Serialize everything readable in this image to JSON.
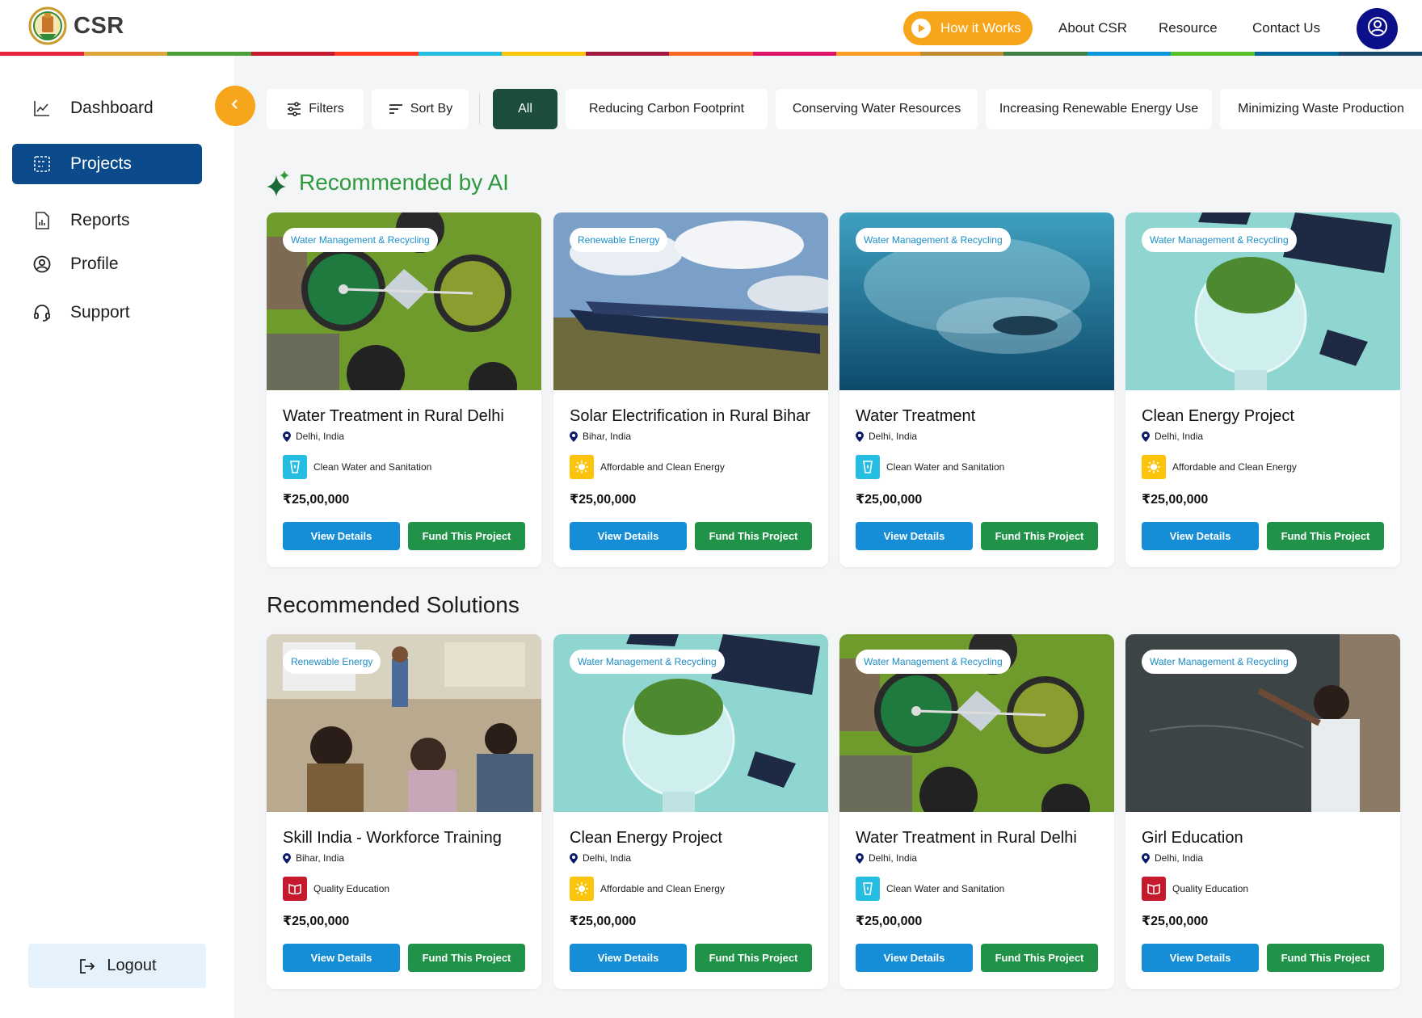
{
  "header": {
    "brand": "CSR",
    "nav": {
      "how_it_works": "How it Works",
      "about": "About CSR",
      "resource": "Resource",
      "contact": "Contact Us"
    },
    "icons": {
      "logo": "state-emblem-logo",
      "play": "play-icon",
      "user": "user-circle-icon"
    },
    "stripe_colors": [
      "#e5243b",
      "#dda63a",
      "#4c9f38",
      "#c5192d",
      "#ff3a21",
      "#26bde2",
      "#fcc30b",
      "#a21942",
      "#fd6925",
      "#dd1367",
      "#fd9d24",
      "#bf8b2e",
      "#3f7e44",
      "#0a97d9",
      "#56c02b",
      "#00689d",
      "#19486a"
    ]
  },
  "sidebar": {
    "items": [
      {
        "label": "Dashboard",
        "icon": "chart-line-icon"
      },
      {
        "label": "Projects",
        "icon": "projects-icon"
      },
      {
        "label": "Reports",
        "icon": "report-icon"
      },
      {
        "label": "Profile",
        "icon": "profile-icon"
      },
      {
        "label": "Support",
        "icon": "headset-icon"
      }
    ],
    "logout": "Logout"
  },
  "filters": {
    "filters_label": "Filters",
    "sort_label": "Sort By",
    "chips": [
      "All",
      "Reducing Carbon Footprint",
      "Conserving Water Resources",
      "Increasing Renewable Energy Use",
      "Minimizing Waste Production"
    ],
    "active_chip": "All"
  },
  "sections": {
    "ai": "Recommended by AI",
    "solutions": "Recommended Solutions"
  },
  "cards_ai": [
    {
      "tag": "Water Management & Recycling",
      "title": "Water Treatment in Rural Delhi",
      "location": "Delhi, India",
      "sdg": "Clean Water and Sanitation",
      "sdg_color": "#26bde2",
      "price": "₹25,00,000",
      "view": "View Details",
      "fund": "Fund This Project",
      "image": "water-treatment-aerial"
    },
    {
      "tag": "Renewable Energy",
      "title": "Solar Electrification in Rural Bihar",
      "location": "Bihar, India",
      "sdg": "Affordable and Clean Energy",
      "sdg_color": "#fcc30b",
      "price": "₹25,00,000",
      "view": "View Details",
      "fund": "Fund This Project",
      "image": "solar-farm"
    },
    {
      "tag": "Water Management & Recycling",
      "title": "Water Treatment",
      "location": "Delhi, India",
      "sdg": "Clean Water and Sanitation",
      "sdg_color": "#26bde2",
      "price": "₹25,00,000",
      "view": "View Details",
      "fund": "Fund This Project",
      "image": "fish-school"
    },
    {
      "tag": "Water Management & Recycling",
      "title": "Clean Energy Project",
      "location": "Delhi, India",
      "sdg": "Affordable and Clean Energy",
      "sdg_color": "#fcc30b",
      "price": "₹25,00,000",
      "view": "View Details",
      "fund": "Fund This Project",
      "image": "bulb-solar"
    }
  ],
  "cards_solutions": [
    {
      "tag": "Renewable Energy",
      "title": "Skill India - Workforce Training",
      "location": "Bihar, India",
      "sdg": "Quality Education",
      "sdg_color": "#c5192d",
      "price": "₹25,00,000",
      "view": "View Details",
      "fund": "Fund This Project",
      "image": "classroom"
    },
    {
      "tag": "Water Management & Recycling",
      "title": "Clean Energy Project",
      "location": "Delhi, India",
      "sdg": "Affordable and Clean Energy",
      "sdg_color": "#fcc30b",
      "price": "₹25,00,000",
      "view": "View Details",
      "fund": "Fund This Project",
      "image": "bulb-solar"
    },
    {
      "tag": "Water Management & Recycling",
      "title": "Water Treatment in Rural Delhi",
      "location": "Delhi, India",
      "sdg": "Clean Water and Sanitation",
      "sdg_color": "#26bde2",
      "price": "₹25,00,000",
      "view": "View Details",
      "fund": "Fund This Project",
      "image": "water-treatment-aerial"
    },
    {
      "tag": "Water Management & Recycling",
      "title": "Girl Education",
      "location": "Delhi, India",
      "sdg": "Quality Education",
      "sdg_color": "#c5192d",
      "price": "₹25,00,000",
      "view": "View Details",
      "fund": "Fund This Project",
      "image": "girl-chalkboard"
    }
  ]
}
